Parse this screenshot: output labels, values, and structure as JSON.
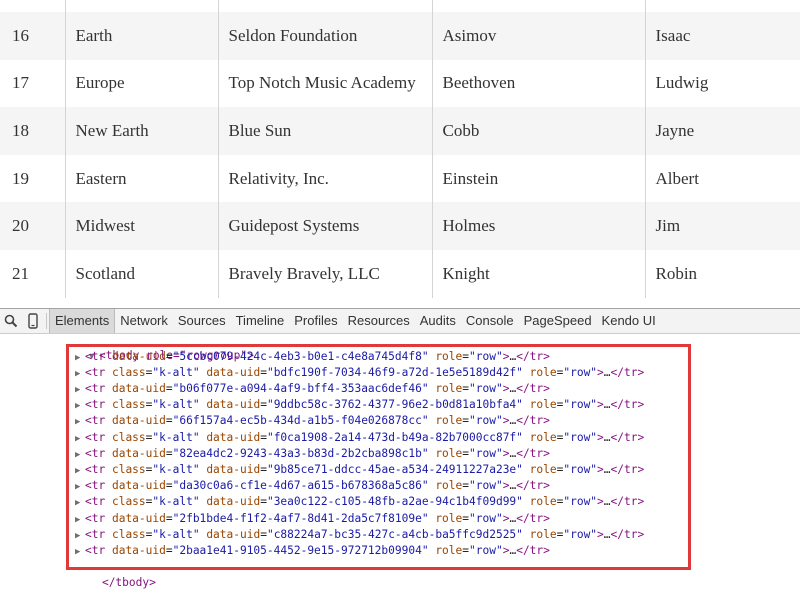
{
  "grid": {
    "rows": [
      [
        "16",
        "Earth",
        "Seldon Foundation",
        "Asimov",
        "Isaac"
      ],
      [
        "17",
        "Europe",
        "Top Notch Music Academy",
        "Beethoven",
        "Ludwig"
      ],
      [
        "18",
        "New Earth",
        "Blue Sun",
        "Cobb",
        "Jayne"
      ],
      [
        "19",
        "Eastern",
        "Relativity, Inc.",
        "Einstein",
        "Albert"
      ],
      [
        "20",
        "Midwest",
        "Guidepost Systems",
        "Holmes",
        "Jim"
      ],
      [
        "21",
        "Scotland",
        "Bravely Bravely, LLC",
        "Knight",
        "Robin"
      ]
    ]
  },
  "devtools": {
    "tabs": [
      "Elements",
      "Network",
      "Sources",
      "Timeline",
      "Profiles",
      "Resources",
      "Audits",
      "Console",
      "PageSpeed",
      "Kendo UI"
    ],
    "active_tab": "Elements",
    "icons": [
      "search-icon",
      "mobile-device-icon"
    ],
    "tbody_open": "<tbody role=\"rowgroup\">",
    "tbody_close": "</tbody>",
    "rows": [
      {
        "class": "",
        "uid": "5ccbc079-424c-4eb3-b0e1-c4e8a745d4f8"
      },
      {
        "class": "k-alt",
        "uid": "bdfc190f-7034-46f9-a72d-1e5e5189d42f"
      },
      {
        "class": "",
        "uid": "b06f077e-a094-4af9-bff4-353aac6def46"
      },
      {
        "class": "k-alt",
        "uid": "9ddbc58c-3762-4377-96e2-b0d81a10bfa4"
      },
      {
        "class": "",
        "uid": "66f157a4-ec5b-434d-a1b5-f04e026878cc"
      },
      {
        "class": "k-alt",
        "uid": "f0ca1908-2a14-473d-b49a-82b7000cc87f"
      },
      {
        "class": "",
        "uid": "82ea4dc2-9243-43a3-b83d-2b2cba898c1b"
      },
      {
        "class": "k-alt",
        "uid": "9b85ce71-ddcc-45ae-a534-24911227a23e"
      },
      {
        "class": "",
        "uid": "da30c0a6-cf1e-4d67-a615-b678368a5c86"
      },
      {
        "class": "k-alt",
        "uid": "3ea0c122-c105-48fb-a2ae-94c1b4f09d99"
      },
      {
        "class": "",
        "uid": "2fb1bde4-f1f2-4af7-8d41-2da5c7f8109e"
      },
      {
        "class": "k-alt",
        "uid": "c88224a7-bc35-427c-a4cb-ba5ffc9d2525"
      },
      {
        "class": "",
        "uid": "2baa1e41-9105-4452-9e15-972712b09904"
      }
    ],
    "row_role": "row",
    "collapsed_content": "…",
    "highlight_color": "#e0393a"
  }
}
